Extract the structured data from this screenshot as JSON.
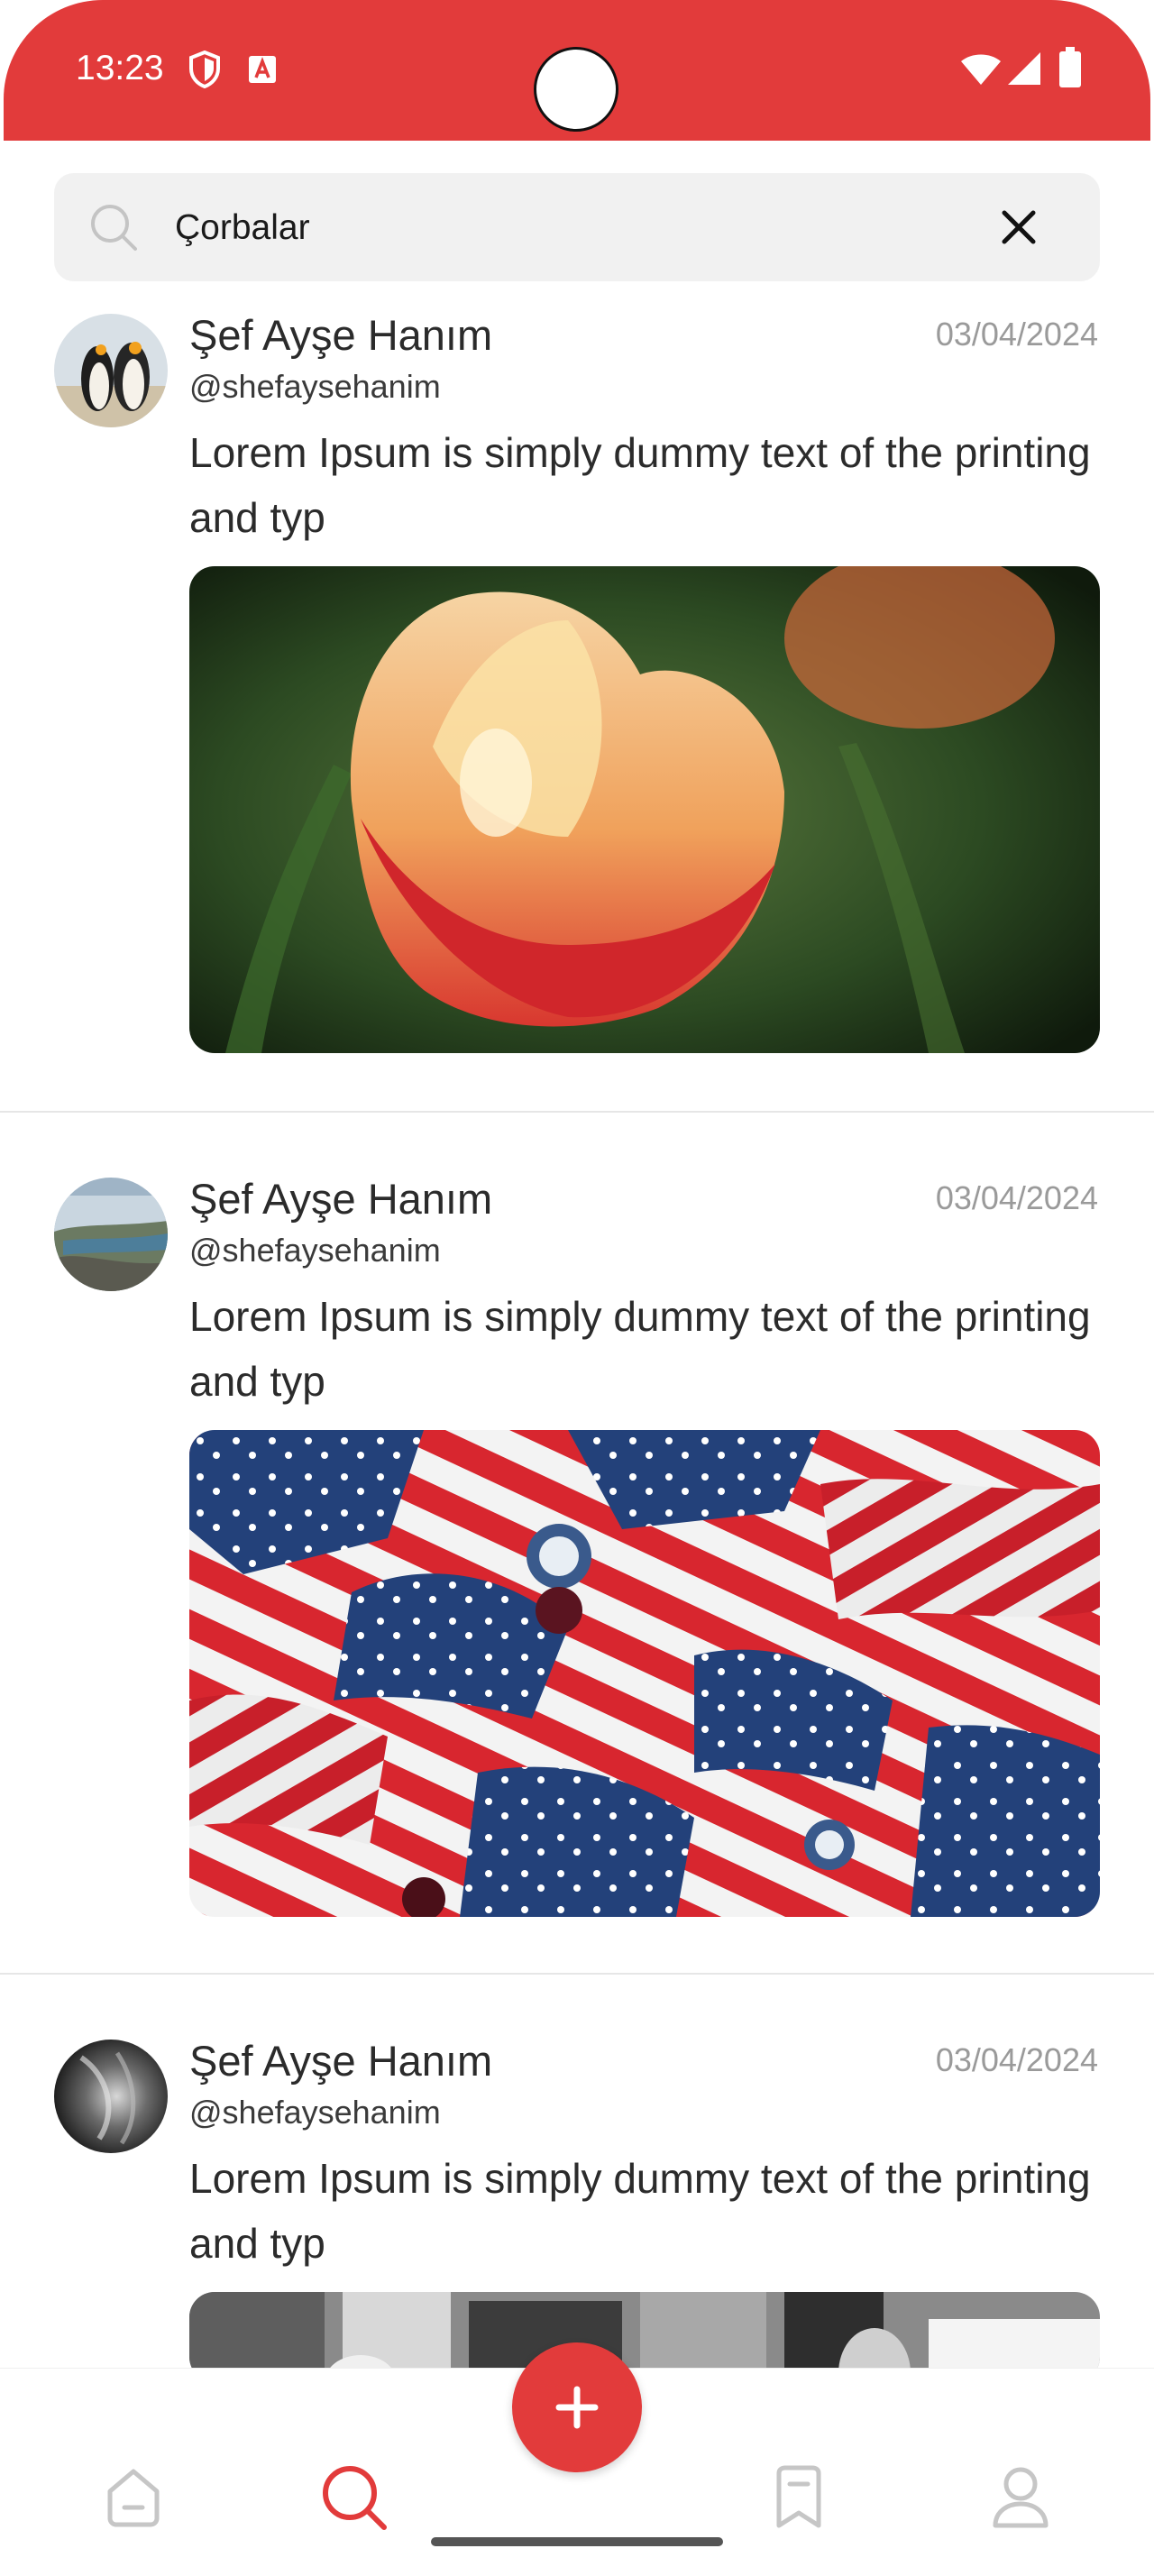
{
  "status_bar": {
    "time": "13:23",
    "icons": [
      "shield-icon",
      "font-icon",
      "wifi-icon",
      "signal-icon",
      "battery-icon"
    ],
    "color": "#e23b3b"
  },
  "search": {
    "value": "Çorbalar",
    "icon": "search-icon",
    "clear_icon": "close-icon"
  },
  "posts": [
    {
      "author": "Şef Ayşe Hanım",
      "handle": "@shefaysehanim",
      "date": "03/04/2024",
      "text": "Lorem Ipsum is simply dummy text of the printing and typ",
      "image": "tulip-photo"
    },
    {
      "author": "Şef Ayşe Hanım",
      "handle": "@shefaysehanim",
      "date": "03/04/2024",
      "text": "Lorem Ipsum is simply dummy text of the printing and typ",
      "image": "flag-bags-photo"
    },
    {
      "author": "Şef Ayşe Hanım",
      "handle": "@shefaysehanim",
      "date": "03/04/2024",
      "text": "Lorem Ipsum is simply dummy text of the printing and typ",
      "image": "street-photo"
    }
  ],
  "bottom_nav": {
    "items": [
      "home-icon",
      "search-icon",
      "add-icon",
      "bookmark-icon",
      "profile-icon"
    ],
    "active": "search-icon",
    "accent": "#e23b3b"
  }
}
